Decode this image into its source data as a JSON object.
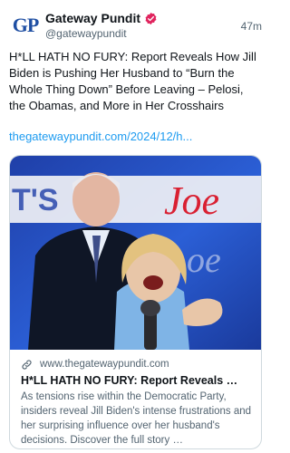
{
  "header": {
    "avatar_logo": "GP",
    "display_name": "Gateway Pundit",
    "handle": "@gatewaypundit",
    "time": "47m"
  },
  "post": {
    "text": "H*LL HATH NO FURY: Report Reveals How Jill Biden is Pushing Her Husband to “Burn the Whole Thing Down” Before Leaving – Pelosi, the Obamas, and More in Her Crosshairs",
    "link": "thegatewaypundit.com/2024/12/h..."
  },
  "card": {
    "background_text": "Joe",
    "banner_fragment": "T'S",
    "domain": "www.thegatewaypundit.com",
    "title": "H*LL HATH NO FURY: Report Reveals …",
    "description": "As tensions rise within the Democratic Party, insiders reveal Jill Biden's intense frustrations and her surprising influence over her husband's decisions. Discover the full story …"
  },
  "colors": {
    "link": "#1d9bf0",
    "verified": "#e0245e",
    "secondary_text": "#536471",
    "banner_red": "#d92032"
  }
}
